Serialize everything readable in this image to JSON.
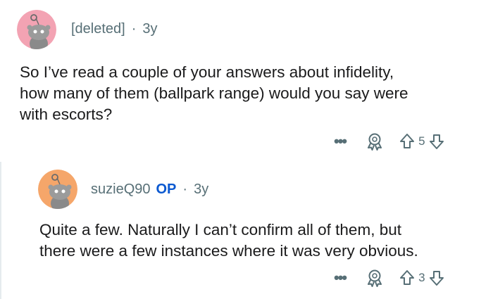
{
  "comments": [
    {
      "username": "[deleted]",
      "separator": "·",
      "age": "3y",
      "text_lines": [
        "So I’ve read a couple of your answers about infidelity,",
        "how many of them (ballpark range) would you say were",
        "with escorts?"
      ],
      "more": "•••",
      "award_icon": "award-icon",
      "upvote_icon": "upvote-arrow-icon",
      "score": "5",
      "downvote_icon": "downvote-arrow-icon",
      "avatar_color": "#f3a3b3"
    },
    {
      "username": "suzieQ90",
      "badge": "OP",
      "separator": "·",
      "age": "3y",
      "text_lines": [
        "Quite a few. Naturally I can’t confirm all of them, but",
        "there were a few instances where it was very obvious."
      ],
      "more": "•••",
      "award_icon": "award-icon",
      "upvote_icon": "upvote-arrow-icon",
      "score": "3",
      "downvote_icon": "downvote-arrow-icon",
      "avatar_color": "#f5a66a"
    }
  ],
  "colors": {
    "op_badge": "#0a58d0",
    "meta_text": "#576f76",
    "body_text": "#1a1a1b"
  }
}
